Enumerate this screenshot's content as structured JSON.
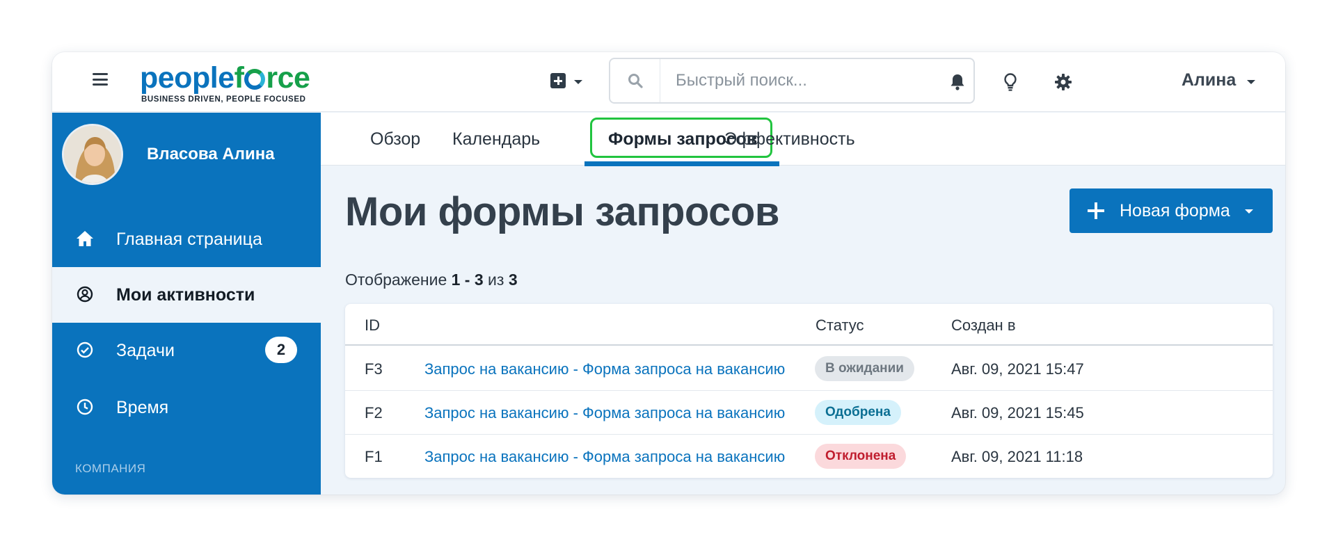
{
  "header": {
    "logo_text_main": "peopleforce",
    "logo_part1": "people",
    "logo_part2": "f",
    "logo_part3": "rce",
    "logo_tagline": "BUSINESS DRIVEN, PEOPLE FOCUSED",
    "search_placeholder": "Быстрый поиск...",
    "user_name": "Алина",
    "icons": [
      "menu-icon",
      "add-icon",
      "search-icon",
      "bell-icon",
      "lightbulb-icon",
      "gear-icon"
    ]
  },
  "sidebar": {
    "profile_name": "Власова Алина",
    "items": [
      {
        "label": "Главная страница",
        "icon": "home-icon",
        "active": false
      },
      {
        "label": "Мои активности",
        "icon": "user-circle-icon",
        "active": true
      },
      {
        "label": "Задачи",
        "icon": "check-circle-icon",
        "active": false,
        "badge": "2"
      },
      {
        "label": "Время",
        "icon": "clock-icon",
        "active": false
      }
    ],
    "section_label": "КОМПАНИЯ"
  },
  "tabs": [
    {
      "label": "Обзор",
      "active": false
    },
    {
      "label": "Календарь",
      "active": false
    },
    {
      "label": "Формы запросов",
      "active": true
    },
    {
      "label": "Эффективность",
      "active": false
    }
  ],
  "main": {
    "title": "Мои формы запросов",
    "new_form_button": "Новая форма",
    "showing_prefix": "Отображение",
    "showing_range": "1 - 3",
    "showing_of": "из",
    "showing_total": "3"
  },
  "table": {
    "columns": [
      "ID",
      "",
      "Статус",
      "Создан в"
    ],
    "rows": [
      {
        "id": "F3",
        "title": "Запрос на вакансию - Форма запроса на вакансию",
        "status": "В ожидании",
        "created": "Авг. 09, 2021 15:47"
      },
      {
        "id": "F2",
        "title": "Запрос на вакансию - Форма запроса на вакансию",
        "status": "Одобрена",
        "created": "Авг. 09, 2021 15:45"
      },
      {
        "id": "F1",
        "title": "Запрос на вакансию - Форма запроса на вакансию",
        "status": "Отклонена",
        "created": "Авг. 09, 2021 11:18"
      }
    ]
  },
  "colors": {
    "brand_blue": "#0a73bd",
    "brand_green": "#16a04a",
    "highlight_green": "#21c43f",
    "status_pending_bg": "#e3e7eb",
    "status_approved_bg": "#d5f1fb",
    "status_rejected_bg": "#fbd9dc"
  }
}
